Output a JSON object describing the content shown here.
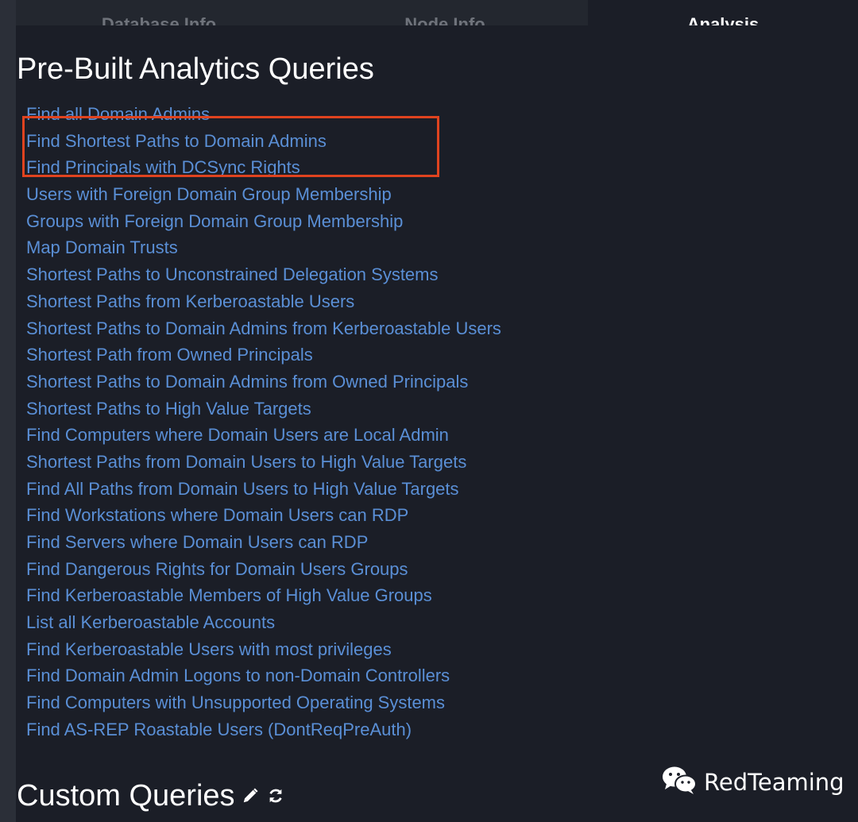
{
  "tabs": [
    {
      "label": "Database Info"
    },
    {
      "label": "Node Info"
    },
    {
      "label": "Analysis"
    }
  ],
  "prebuilt": {
    "title": "Pre-Built Analytics Queries",
    "queries": [
      "Find all Domain Admins",
      "Find Shortest Paths to Domain Admins",
      "Find Principals with DCSync Rights",
      "Users with Foreign Domain Group Membership",
      "Groups with Foreign Domain Group Membership",
      "Map Domain Trusts",
      "Shortest Paths to Unconstrained Delegation Systems",
      "Shortest Paths from Kerberoastable Users",
      "Shortest Paths to Domain Admins from Kerberoastable Users",
      "Shortest Path from Owned Principals",
      "Shortest Paths to Domain Admins from Owned Principals",
      "Shortest Paths to High Value Targets",
      "Find Computers where Domain Users are Local Admin",
      "Shortest Paths from Domain Users to High Value Targets",
      "Find All Paths from Domain Users to High Value Targets",
      "Find Workstations where Domain Users can RDP",
      "Find Servers where Domain Users can RDP",
      "Find Dangerous Rights for Domain Users Groups",
      "Find Kerberoastable Members of High Value Groups",
      "List all Kerberoastable Accounts",
      "Find Kerberoastable Users with most privileges",
      "Find Domain Admin Logons to non-Domain Controllers",
      "Find Computers with Unsupported Operating Systems",
      "Find AS-REP Roastable Users (DontReqPreAuth)"
    ]
  },
  "custom": {
    "title": "Custom Queries",
    "edit_icon": "pencil-icon",
    "refresh_icon": "refresh-icon"
  },
  "watermark": {
    "text": "RedTeaming",
    "icon": "wechat-icon"
  },
  "colors": {
    "background": "#1b1e27",
    "link": "#5a8fd6",
    "highlight": "#e0431f"
  }
}
